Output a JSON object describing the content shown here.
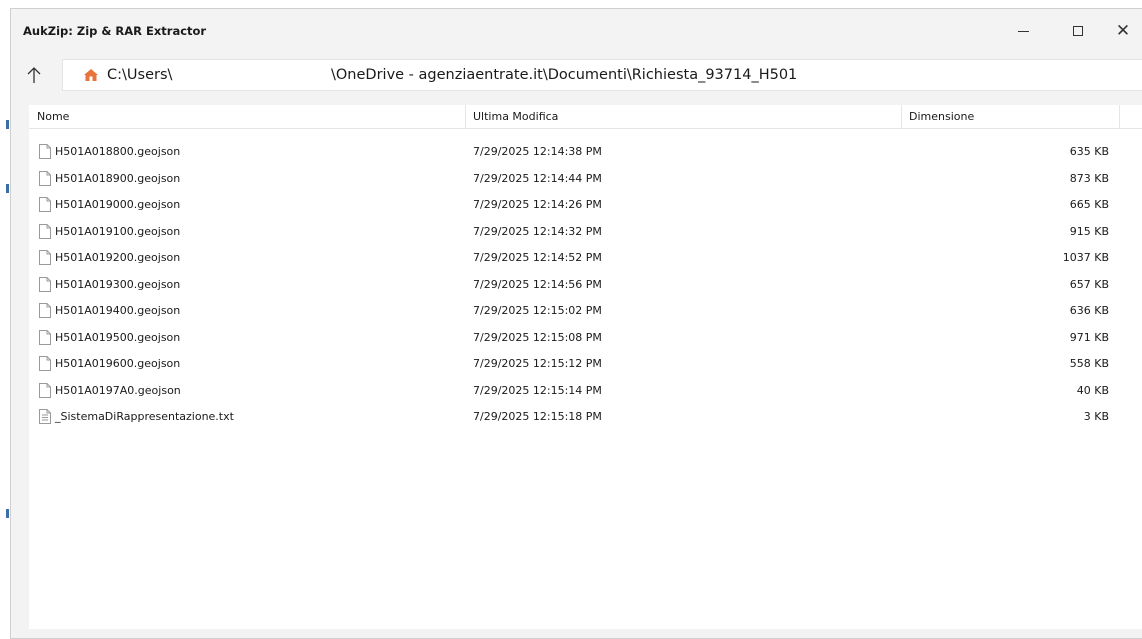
{
  "window": {
    "title": "AukZip: Zip & RAR Extractor",
    "controls": {
      "minimize": "—",
      "maximize": "☐",
      "close": "✕"
    }
  },
  "address": {
    "path_start": "C:\\Users\\",
    "path_end": "\\OneDrive - agenziaentrate.it\\Documenti\\Richiesta_93714_H501",
    "icons": {
      "up": "arrow-up-icon",
      "home": "home-icon"
    },
    "home_color": "#e8743b"
  },
  "table": {
    "columns": {
      "name": "Nome",
      "date": "Ultima Modifica",
      "size": "Dimensione"
    },
    "rows": [
      {
        "name": "H501A018800.geojson",
        "date": "7/29/2025 12:14:38 PM",
        "size": "635 KB",
        "type": "file"
      },
      {
        "name": "H501A018900.geojson",
        "date": "7/29/2025 12:14:44 PM",
        "size": "873 KB",
        "type": "file"
      },
      {
        "name": "H501A019000.geojson",
        "date": "7/29/2025 12:14:26 PM",
        "size": "665 KB",
        "type": "file"
      },
      {
        "name": "H501A019100.geojson",
        "date": "7/29/2025 12:14:32 PM",
        "size": "915 KB",
        "type": "file"
      },
      {
        "name": "H501A019200.geojson",
        "date": "7/29/2025 12:14:52 PM",
        "size": "1037 KB",
        "type": "file"
      },
      {
        "name": "H501A019300.geojson",
        "date": "7/29/2025 12:14:56 PM",
        "size": "657 KB",
        "type": "file"
      },
      {
        "name": "H501A019400.geojson",
        "date": "7/29/2025 12:15:02 PM",
        "size": "636 KB",
        "type": "file"
      },
      {
        "name": "H501A019500.geojson",
        "date": "7/29/2025 12:15:08 PM",
        "size": "971 KB",
        "type": "file"
      },
      {
        "name": "H501A019600.geojson",
        "date": "7/29/2025 12:15:12 PM",
        "size": "558 KB",
        "type": "file"
      },
      {
        "name": "H501A0197A0.geojson",
        "date": "7/29/2025 12:15:14 PM",
        "size": "40 KB",
        "type": "file"
      },
      {
        "name": "_SistemaDiRappresentazione.txt",
        "date": "7/29/2025 12:15:18 PM",
        "size": "3 KB",
        "type": "text"
      }
    ]
  }
}
